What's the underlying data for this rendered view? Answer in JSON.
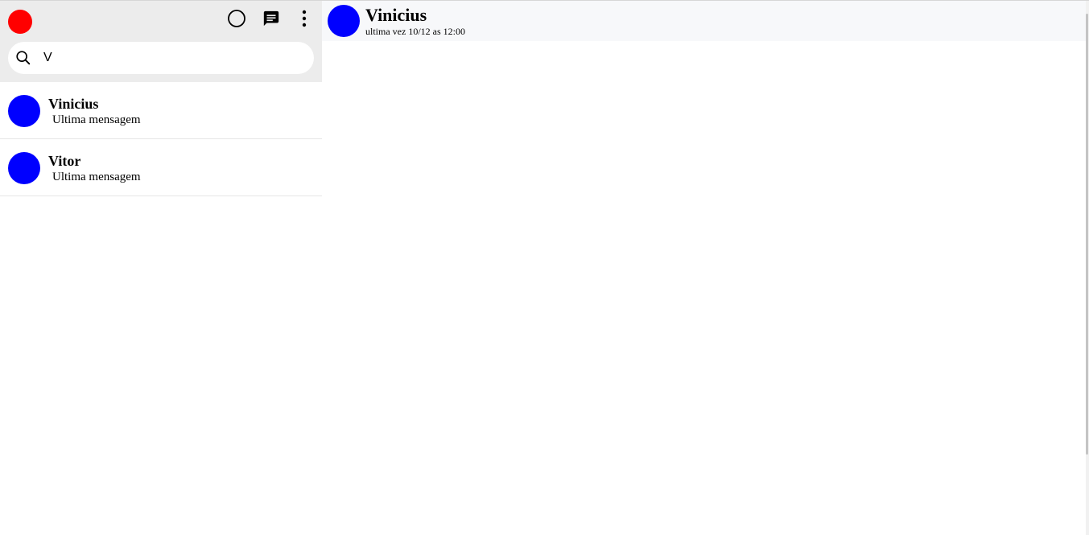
{
  "colors": {
    "my_avatar": "#ff0000",
    "contact_avatar": "#0000ff"
  },
  "sidebar": {
    "header_icons": [
      "status-icon",
      "new-chat-icon",
      "menu-dots-icon"
    ],
    "search": {
      "value": "V",
      "placeholder": ""
    },
    "chats": [
      {
        "name": "Vinicius",
        "preview": "Ultima mensagem"
      },
      {
        "name": "Vitor",
        "preview": "Ultima mensagem"
      }
    ]
  },
  "chat": {
    "contact_name": "Vinicius",
    "last_seen": "ultima vez 10/12 as 12:00"
  }
}
